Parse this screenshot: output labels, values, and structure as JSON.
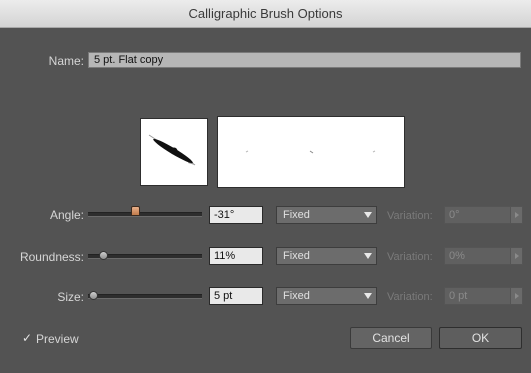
{
  "window": {
    "title": "Calligraphic Brush Options"
  },
  "name_field": {
    "label": "Name:",
    "value": "5 pt. Flat copy"
  },
  "rows": [
    {
      "label": "Angle:",
      "value": "-31°",
      "mode": "Fixed",
      "variation_label": "Variation:",
      "variation_value": "0°"
    },
    {
      "label": "Roundness:",
      "value": "11%",
      "mode": "Fixed",
      "variation_label": "Variation:",
      "variation_value": "0%"
    },
    {
      "label": "Size:",
      "value": "5 pt",
      "mode": "Fixed",
      "variation_label": "Variation:",
      "variation_value": "0 pt"
    }
  ],
  "preview": {
    "label": "Preview",
    "checked": true
  },
  "buttons": {
    "cancel": "Cancel",
    "ok": "OK"
  },
  "icons": {
    "dropdown": "chevron-down-icon",
    "stepper": "chevron-right-icon",
    "check": "checkmark-icon"
  }
}
